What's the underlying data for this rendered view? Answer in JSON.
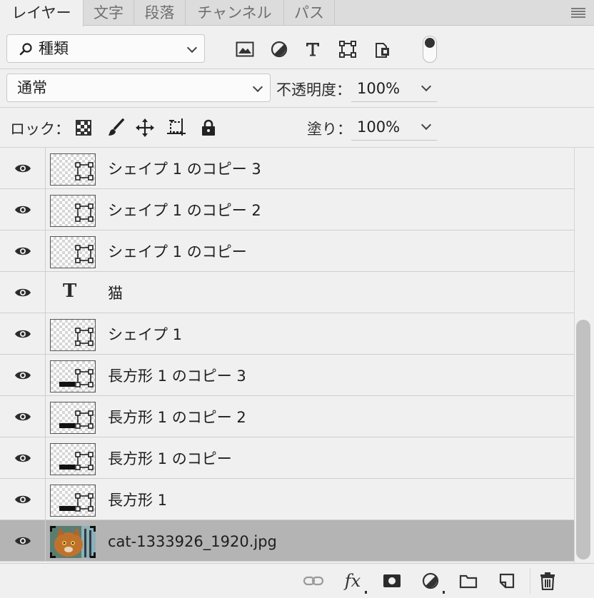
{
  "tabs": [
    {
      "label": "レイヤー",
      "active": true
    },
    {
      "label": "文字",
      "active": false
    },
    {
      "label": "段落",
      "active": false
    },
    {
      "label": "チャンネル",
      "active": false
    },
    {
      "label": "パス",
      "active": false
    }
  ],
  "filter": {
    "kind_label": "種類",
    "icons": [
      "image-filter-icon",
      "adjustment-filter-icon",
      "type-filter-icon",
      "shape-filter-icon",
      "smart-object-filter-icon"
    ]
  },
  "blend": {
    "mode": "通常",
    "opacity_label": "不透明度：",
    "opacity_value": "100%"
  },
  "lock": {
    "label": "ロック：",
    "fill_label": "塗り：",
    "fill_value": "100%",
    "icons": [
      "lock-transparent-pixels-icon",
      "lock-image-pixels-icon",
      "lock-position-icon",
      "lock-artboard-icon",
      "lock-all-icon"
    ]
  },
  "layers": [
    {
      "name": "シェイプ 1 のコピー 3",
      "kind": "shape",
      "visible": true,
      "selected": false
    },
    {
      "name": "シェイプ 1 のコピー 2",
      "kind": "shape",
      "visible": true,
      "selected": false
    },
    {
      "name": "シェイプ 1 のコピー",
      "kind": "shape",
      "visible": true,
      "selected": false
    },
    {
      "name": "猫",
      "kind": "text",
      "visible": true,
      "selected": false
    },
    {
      "name": "シェイプ 1",
      "kind": "shape",
      "visible": true,
      "selected": false
    },
    {
      "name": "長方形 1 のコピー 3",
      "kind": "rect",
      "visible": true,
      "selected": false
    },
    {
      "name": "長方形 1 のコピー 2",
      "kind": "rect",
      "visible": true,
      "selected": false
    },
    {
      "name": "長方形 1 のコピー",
      "kind": "rect",
      "visible": true,
      "selected": false
    },
    {
      "name": "長方形 1",
      "kind": "rect",
      "visible": true,
      "selected": false
    },
    {
      "name": "cat-1333926_1920.jpg",
      "kind": "photo",
      "visible": true,
      "selected": true
    }
  ],
  "footer": {
    "icons": [
      "link-layers-icon",
      "fx-icon",
      "add-mask-icon",
      "new-adjustment-layer-icon",
      "new-group-icon",
      "new-layer-icon",
      "delete-layer-icon"
    ],
    "fx_label": "fx"
  }
}
